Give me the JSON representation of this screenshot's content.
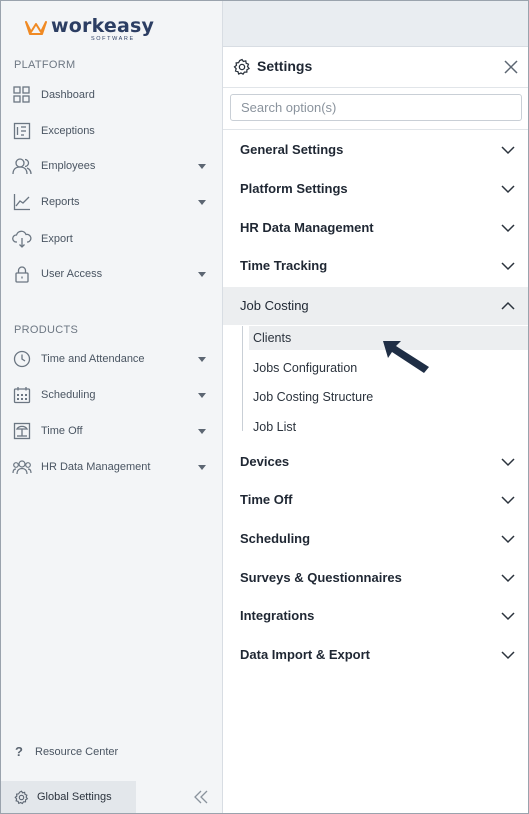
{
  "brand": {
    "name": "workeasy",
    "sub": "SOFTWARE",
    "accent": "#f08a24",
    "navy": "#2c3e63"
  },
  "sidebar": {
    "platform_label": "PLATFORM",
    "products_label": "PRODUCTS",
    "platform_items": [
      {
        "label": "Dashboard",
        "icon": "grid-icon",
        "caret": false
      },
      {
        "label": "Exceptions",
        "icon": "list-doc-icon",
        "caret": false
      },
      {
        "label": "Employees",
        "icon": "users-icon",
        "caret": true
      },
      {
        "label": "Reports",
        "icon": "chart-line-icon",
        "caret": true
      },
      {
        "label": "Export",
        "icon": "cloud-export-icon",
        "caret": false
      },
      {
        "label": "User Access",
        "icon": "lock-icon",
        "caret": true
      }
    ],
    "product_items": [
      {
        "label": "Time and Attendance",
        "icon": "clock-icon",
        "caret": true
      },
      {
        "label": "Scheduling",
        "icon": "calendar-icon",
        "caret": true
      },
      {
        "label": "Time Off",
        "icon": "beach-icon",
        "caret": true
      },
      {
        "label": "HR Data Management",
        "icon": "group-icon",
        "caret": true
      }
    ],
    "resource_center": "Resource Center",
    "global_settings": "Global Settings"
  },
  "settings": {
    "title": "Settings",
    "search_placeholder": "Search option(s)",
    "sections": [
      "General Settings",
      "Platform Settings",
      "HR Data Management",
      "Time Tracking",
      "Job Costing",
      "Devices",
      "Time Off",
      "Scheduling",
      "Surveys & Questionnaires",
      "Integrations",
      "Data Import & Export"
    ],
    "job_costing_items": [
      "Clients",
      "Jobs Configuration",
      "Job Costing Structure",
      "Job List"
    ]
  }
}
